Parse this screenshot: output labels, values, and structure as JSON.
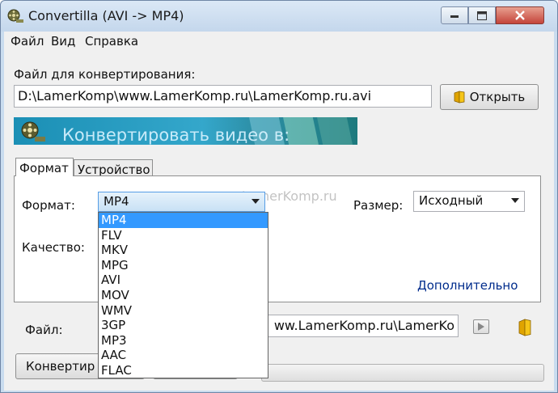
{
  "window": {
    "title": "Convertilla  (AVI -> MP4)"
  },
  "menu": [
    "Файл",
    "Вид",
    "Справка"
  ],
  "source": {
    "label": "Файл для конвертирования:",
    "path": "D:\\LamerKomp\\www.LamerKomp.ru\\LamerKomp.ru.avi",
    "open_button": "Открыть"
  },
  "banner": {
    "text": "Конвертировать видео в:"
  },
  "tabs": [
    {
      "label": "Формат",
      "active": true
    },
    {
      "label": "Устройство",
      "active": false
    }
  ],
  "format_tab": {
    "format_label": "Формат:",
    "format_value": "MP4",
    "size_label": "Размер:",
    "size_value": "Исходный",
    "quality_label": "Качество:",
    "more_link": "Дополнительно",
    "watermark": "www.LamerKomp.ru"
  },
  "format_options": [
    "MP4",
    "FLV",
    "MKV",
    "MPG",
    "AVI",
    "MOV",
    "WMV",
    "3GP",
    "MP3",
    "AAC",
    "FLAC"
  ],
  "output": {
    "label": "Файл:",
    "path_visible": "ww.LamerKomp.ru\\LamerKo"
  },
  "convert_button": "Конвертир",
  "icons": {
    "app": "film-reel-icon",
    "open": "folder-icon",
    "play": "play-icon",
    "output_folder": "folder-icon"
  },
  "colors": {
    "selection": "#3399ff",
    "link": "#002c8c",
    "banner": "#2a9fc7"
  }
}
